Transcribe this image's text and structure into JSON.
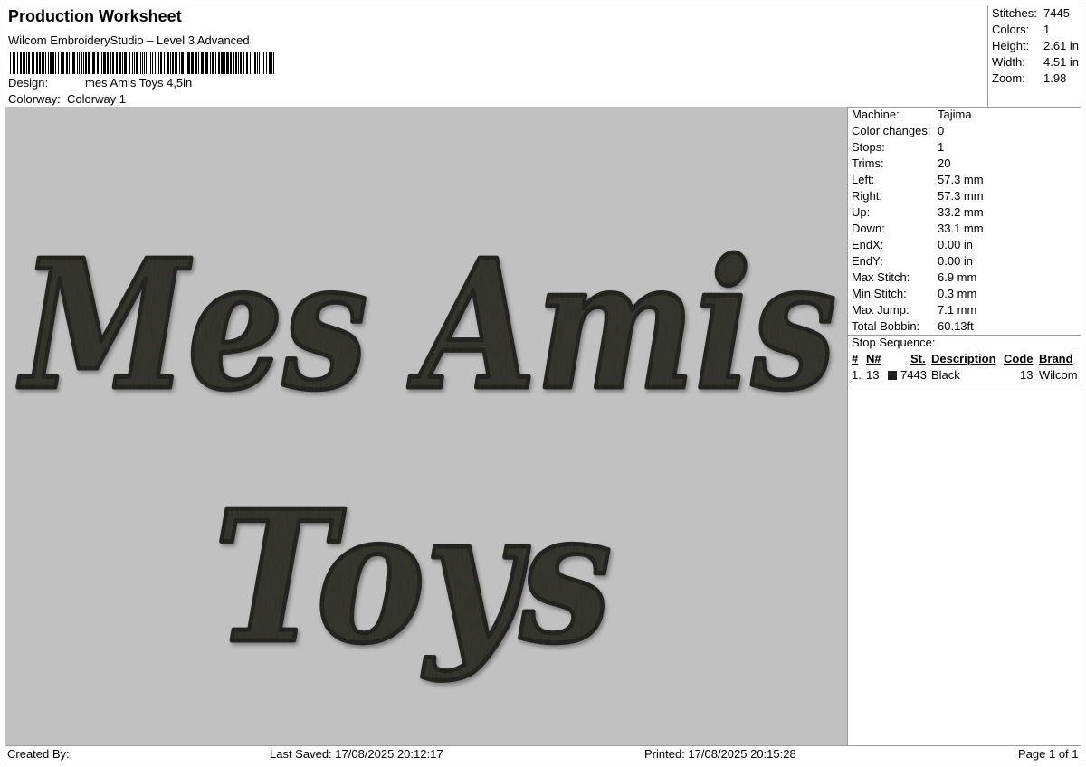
{
  "header": {
    "title": "Production Worksheet",
    "subtitle": "Wilcom EmbroideryStudio – Level 3 Advanced",
    "design_label": "Design:",
    "design_value": "mes Amis Toys 4,5in",
    "colorway_label": "Colorway:",
    "colorway_value": "Colorway 1"
  },
  "stats": {
    "stitches_label": "Stitches:",
    "stitches_value": "7445",
    "colors_label": "Colors:",
    "colors_value": "1",
    "height_label": "Height:",
    "height_value": "2.61 in",
    "width_label": "Width:",
    "width_value": "4.51 in",
    "zoom_label": "Zoom:",
    "zoom_value": "1.98"
  },
  "machine": {
    "rows": [
      {
        "label": "Machine:",
        "value": "Tajima"
      },
      {
        "label": "Color changes:",
        "value": "0"
      },
      {
        "label": "Stops:",
        "value": "1"
      },
      {
        "label": "Trims:",
        "value": "20"
      },
      {
        "label": "Left:",
        "value": "57.3 mm"
      },
      {
        "label": "Right:",
        "value": "57.3 mm"
      },
      {
        "label": "Up:",
        "value": "33.2 mm"
      },
      {
        "label": "Down:",
        "value": "33.1 mm"
      },
      {
        "label": "EndX:",
        "value": "0.00 in"
      },
      {
        "label": "EndY:",
        "value": "0.00 in"
      },
      {
        "label": "Max Stitch:",
        "value": "6.9 mm"
      },
      {
        "label": "Min Stitch:",
        "value": "0.3 mm"
      },
      {
        "label": "Max Jump:",
        "value": "7.1 mm"
      },
      {
        "label": "Total Bobbin:",
        "value": "60.13ft"
      }
    ]
  },
  "stop_sequence": {
    "title": "Stop Sequence:",
    "headers": {
      "num": "#",
      "n": "N#",
      "st": "St.",
      "description": "Description",
      "code": "Code",
      "brand": "Brand"
    },
    "rows": [
      {
        "num": "1.",
        "n": "13",
        "st": "7443",
        "description": "Black",
        "code": "13",
        "brand": "Wilcom",
        "swatch_color": "#1e1e1e"
      }
    ]
  },
  "design_preview": {
    "line1": "Mes Amis",
    "line2": "Toys",
    "thread_color": "#3b3a35",
    "background_color": "#c1c1c1"
  },
  "footer": {
    "created_by": "Created By:",
    "last_saved": "Last Saved: 17/08/2025 20:12:17",
    "printed": "Printed: 17/08/2025 20:15:28",
    "page": "Page 1 of 1"
  }
}
